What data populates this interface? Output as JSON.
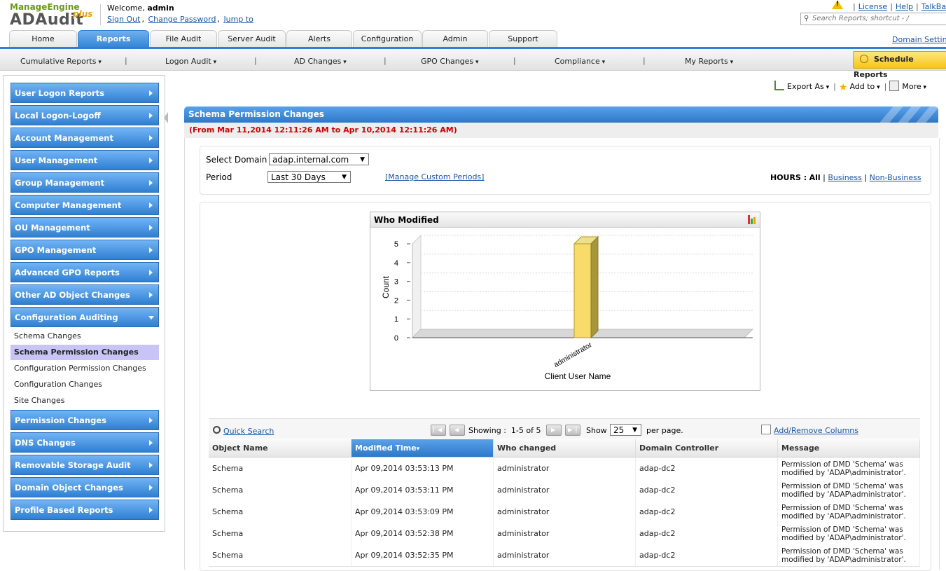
{
  "brand": {
    "top": "ManageEngine",
    "name": "ADAudit",
    "plus": "plus"
  },
  "header": {
    "welcome_prefix": "Welcome,",
    "user": "admin",
    "links": [
      "Sign Out",
      "Change Password",
      "Jump to"
    ],
    "top_links": [
      "License",
      "Help",
      "TalkBa"
    ],
    "search_placeholder": "Search Reports; shortcut - /",
    "domain_settings": "Domain Settin"
  },
  "tabs": [
    {
      "label": "Home"
    },
    {
      "label": "Reports",
      "active": true
    },
    {
      "label": "File Audit"
    },
    {
      "label": "Server Audit"
    },
    {
      "label": "Alerts"
    },
    {
      "label": "Configuration"
    },
    {
      "label": "Admin"
    },
    {
      "label": "Support"
    }
  ],
  "subnav": [
    "Cumulative Reports",
    "Logon Audit",
    "AD Changes",
    "GPO Changes",
    "Compliance",
    "My Reports"
  ],
  "schedule_reports": "Schedule Reports",
  "sidebar": {
    "items": [
      "User Logon Reports",
      "Local Logon-Logoff",
      "Account Management",
      "User Management",
      "Group Management",
      "Computer Management",
      "OU Management",
      "GPO Management",
      "Advanced GPO Reports",
      "Other AD Object Changes",
      "Configuration Auditing"
    ],
    "expanded_sub": [
      "Schema Changes",
      "Schema Permission Changes",
      "Configuration Permission Changes",
      "Configuration Changes",
      "Site Changes"
    ],
    "active_sub": "Schema Permission Changes",
    "items_after": [
      "Permission Changes",
      "DNS Changes",
      "Removable Storage Audit",
      "Domain Object Changes",
      "Profile Based Reports"
    ]
  },
  "toolbar": {
    "export": "Export As",
    "add_to": "Add to",
    "more": "More"
  },
  "report": {
    "title": "Schema Permission Changes",
    "range": "(From Mar 11,2014 12:11:26 AM to Apr 10,2014 12:11:26 AM)",
    "select_domain_label": "Select Domain",
    "domain_value": "adap.internal.com",
    "period_label": "Period",
    "period_value": "Last 30 Days",
    "manage_periods": "[Manage Custom Periods]",
    "hours_label": "HOURS :",
    "hours_all": "All",
    "hours_business": "Business",
    "hours_non_business": "Non-Business"
  },
  "chart_data": {
    "type": "bar",
    "title": "Who Modified",
    "categories": [
      "administrator"
    ],
    "values": [
      5
    ],
    "xlabel": "Client User Name",
    "ylabel": "Count",
    "ylim": [
      0,
      5
    ],
    "yticks": [
      "0",
      "1",
      "2",
      "3",
      "4",
      "5"
    ],
    "bar_color": "#f7dc6a"
  },
  "grid": {
    "quick_search": "Quick Search",
    "showing_label": "Showing :",
    "showing_range": "1-5 of 5",
    "show_label": "Show",
    "per_page_value": "25",
    "per_page_label": "per page.",
    "add_remove_columns": "Add/Remove Columns",
    "columns": [
      "Object Name",
      "Modified Time",
      "Who changed",
      "Domain Controller",
      "Message"
    ],
    "sorted_column": "Modified Time",
    "rows": [
      [
        "Schema",
        "Apr 09,2014 03:53:13 PM",
        "administrator",
        "adap-dc2",
        "Permission of DMD 'Schema' was modified by 'ADAP\\administrator'."
      ],
      [
        "Schema",
        "Apr 09,2014 03:53:11 PM",
        "administrator",
        "adap-dc2",
        "Permission of DMD 'Schema' was modified by 'ADAP\\administrator'."
      ],
      [
        "Schema",
        "Apr 09,2014 03:53:09 PM",
        "administrator",
        "adap-dc2",
        "Permission of DMD 'Schema' was modified by 'ADAP\\administrator'."
      ],
      [
        "Schema",
        "Apr 09,2014 03:52:38 PM",
        "administrator",
        "adap-dc2",
        "Permission of DMD 'Schema' was modified by 'ADAP\\administrator'."
      ],
      [
        "Schema",
        "Apr 09,2014 03:52:35 PM",
        "administrator",
        "adap-dc2",
        "Permission of DMD 'Schema' was modified by 'ADAP\\administrator'."
      ]
    ]
  }
}
